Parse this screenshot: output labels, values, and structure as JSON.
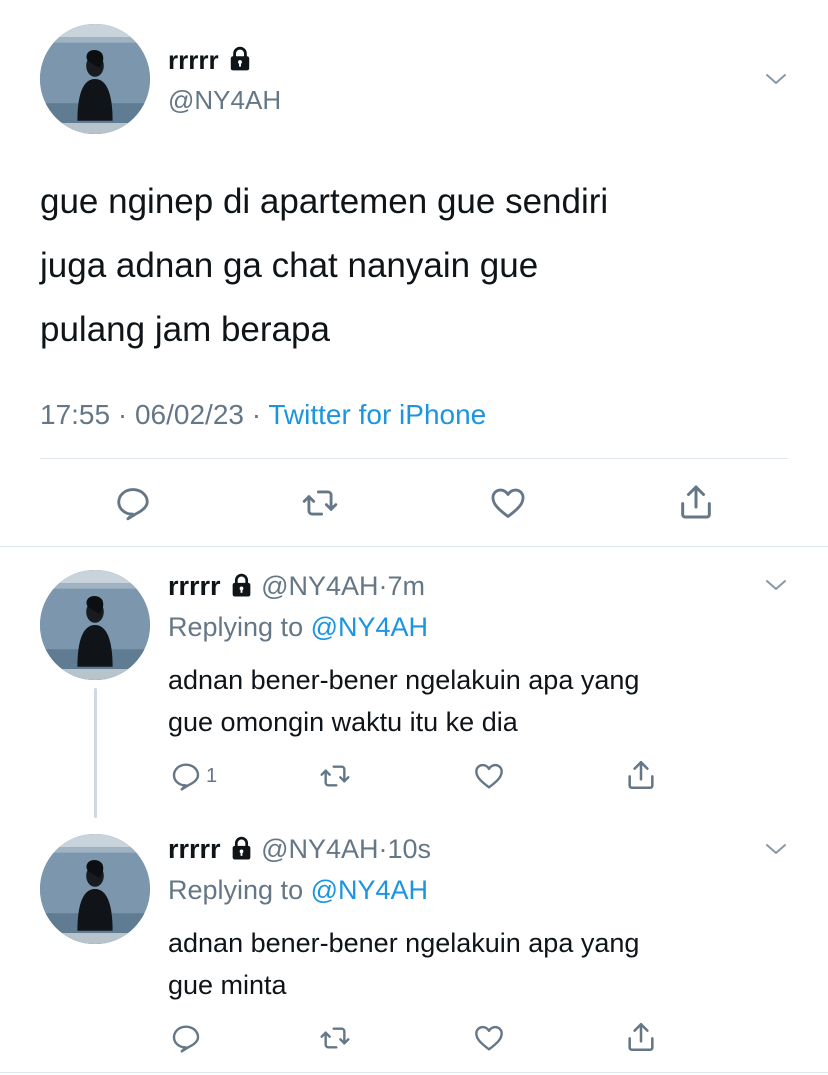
{
  "main_tweet": {
    "display_name": "rrrrr",
    "handle": "@NY4AH",
    "text_lines": [
      "gue nginep di apartemen gue sendiri",
      "juga adnan ga chat nanyain gue",
      "pulang jam berapa"
    ],
    "time": "17:55",
    "date": "06/02/23",
    "separator": "·",
    "source": "Twitter for iPhone"
  },
  "replies": [
    {
      "display_name": "rrrrr",
      "handle": "@NY4AH",
      "dot": "·",
      "age": "7m",
      "replying_prefix": "Replying to",
      "replying_to": "@NY4AH",
      "text_lines": [
        "adnan bener-bener ngelakuin apa yang",
        "gue omongin waktu itu ke dia"
      ],
      "reply_count": "1"
    },
    {
      "display_name": "rrrrr",
      "handle": "@NY4AH",
      "dot": "·",
      "age": "10s",
      "replying_prefix": "Replying to",
      "replying_to": "@NY4AH",
      "text_lines": [
        "adnan bener-bener ngelakuin apa yang",
        "gue minta"
      ],
      "reply_count": ""
    }
  ],
  "icons": [
    "lock-icon",
    "chevron-down-icon",
    "reply-icon",
    "retweet-icon",
    "like-icon",
    "share-icon"
  ],
  "colors": {
    "text": "#0f1419",
    "muted": "#657786",
    "link": "#1b95e0",
    "divider": "#e1e8ed"
  }
}
